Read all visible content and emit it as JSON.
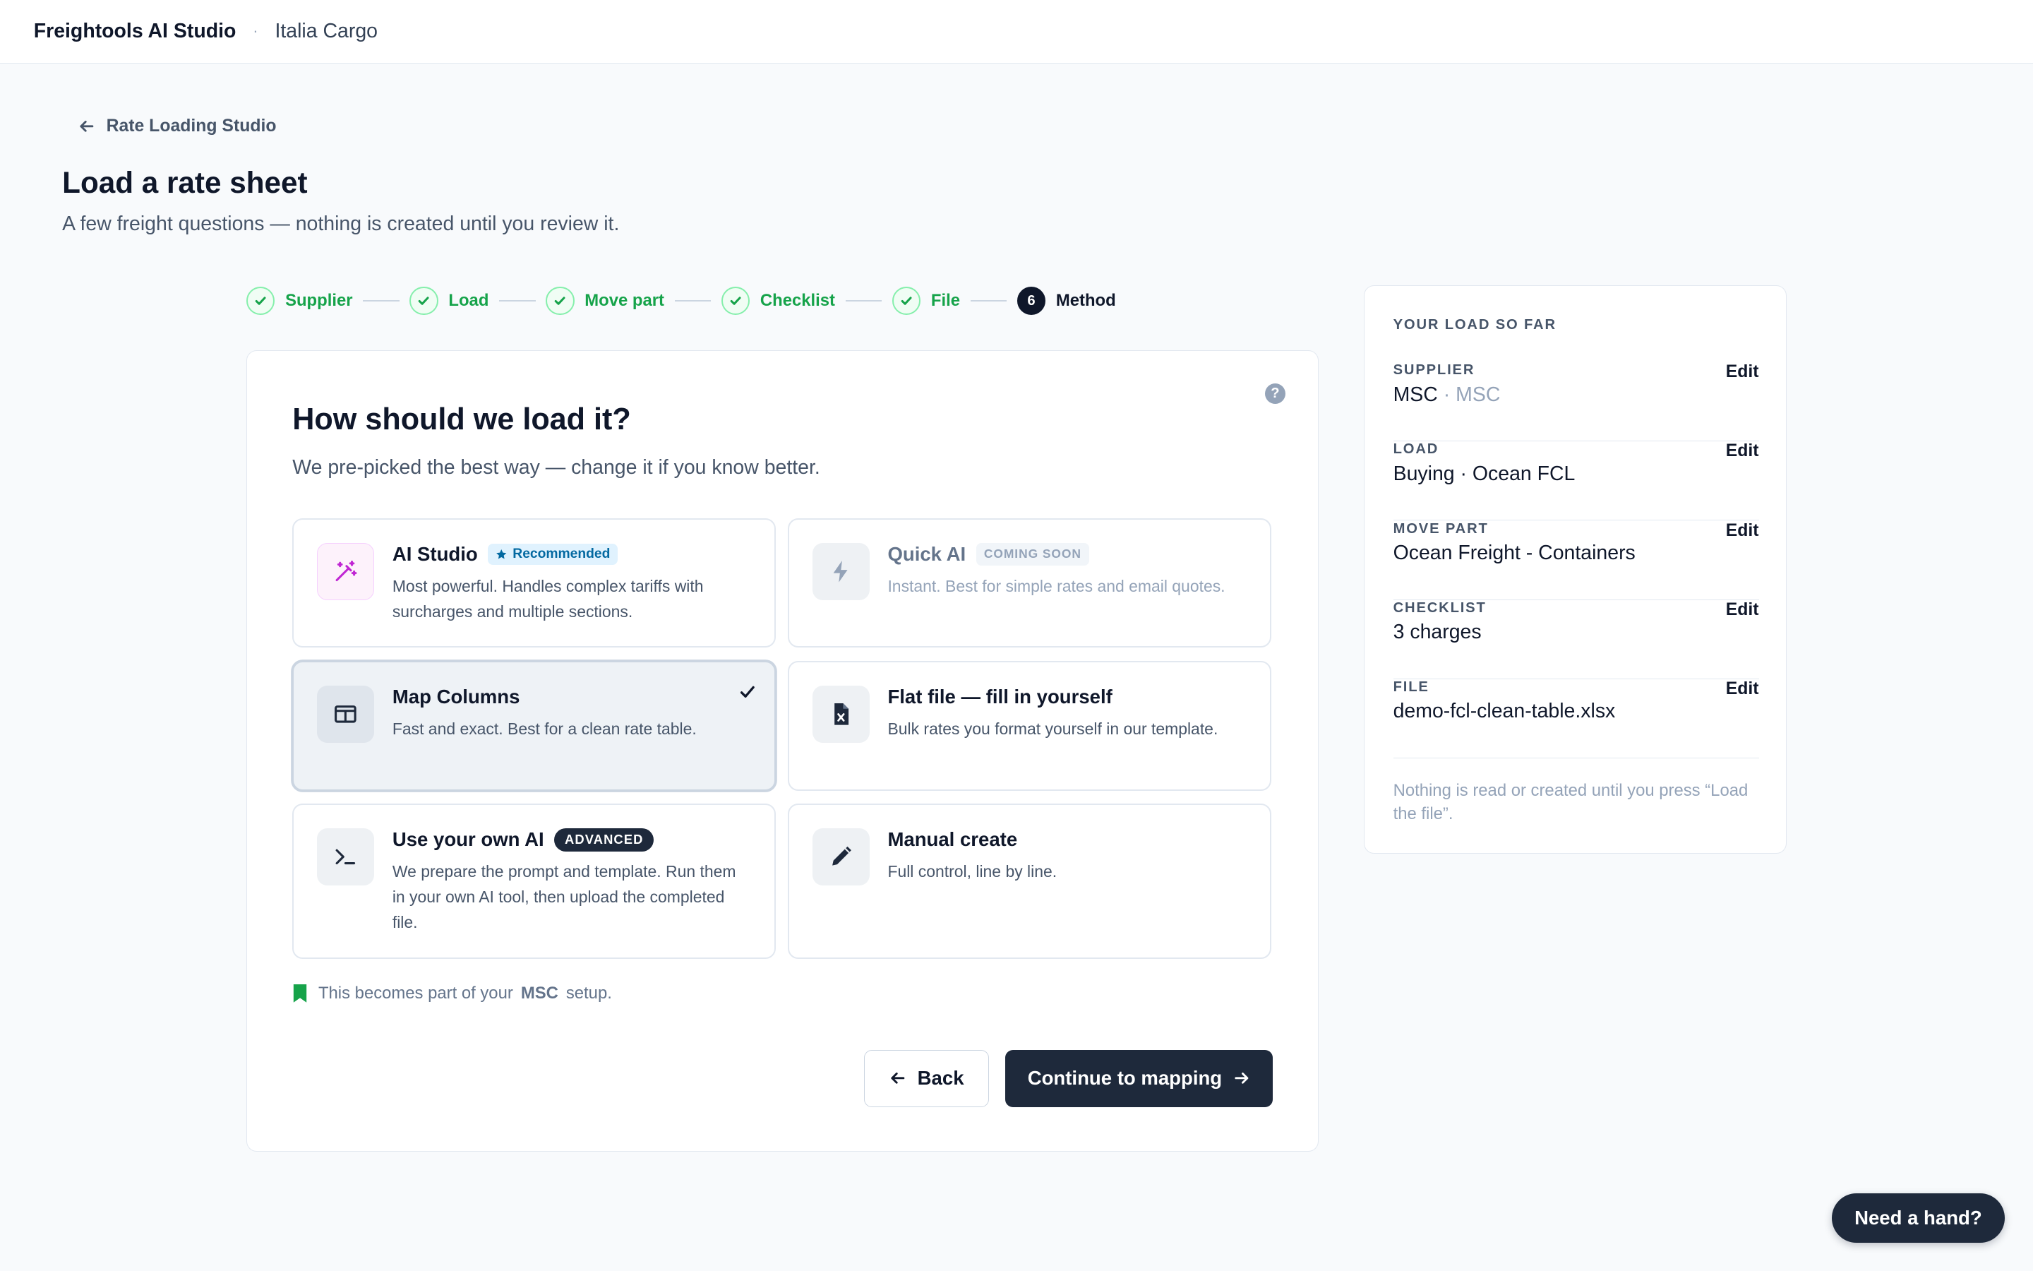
{
  "app": {
    "title": "Freightools AI Studio",
    "separator": "·",
    "org": "Italia Cargo"
  },
  "nav": {
    "back_label": "Rate Loading Studio"
  },
  "page": {
    "title": "Load a rate sheet",
    "subtitle": "A few freight questions — nothing is created until you review it."
  },
  "stepper": {
    "steps": [
      {
        "label": "Supplier",
        "state": "done"
      },
      {
        "label": "Load",
        "state": "done"
      },
      {
        "label": "Move part",
        "state": "done"
      },
      {
        "label": "Checklist",
        "state": "done"
      },
      {
        "label": "File",
        "state": "done"
      },
      {
        "label": "Method",
        "number": "6",
        "state": "current"
      }
    ]
  },
  "method": {
    "help": "?",
    "title": "How should we load it?",
    "subtitle": "We pre-picked the best way — change it if you know better.",
    "options": [
      {
        "id": "ai-studio",
        "title": "AI Studio",
        "badge": "Recommended",
        "icon": "magic-wand-icon",
        "desc": "Most powerful. Handles complex tariffs with surcharges and multiple sections."
      },
      {
        "id": "quick-ai",
        "title": "Quick AI",
        "badge": "COMING SOON",
        "icon": "lightning-icon",
        "desc": "Instant. Best for simple rates and email quotes.",
        "disabled": true
      },
      {
        "id": "map-columns",
        "title": "Map Columns",
        "icon": "columns-icon",
        "desc": "Fast and exact. Best for a clean rate table.",
        "selected": true
      },
      {
        "id": "flat-file",
        "title": "Flat file — fill in yourself",
        "icon": "excel-file-icon",
        "desc": "Bulk rates you format yourself in our template."
      },
      {
        "id": "own-ai",
        "title": "Use your own AI",
        "badge": "ADVANCED",
        "icon": "terminal-icon",
        "desc": "We prepare the prompt and template. Run them in your own AI tool, then upload the completed file."
      },
      {
        "id": "manual",
        "title": "Manual create",
        "icon": "pencil-icon",
        "desc": "Full control, line by line."
      }
    ],
    "note": {
      "prefix": "This becomes part of your",
      "supplier": "MSC",
      "suffix": "setup."
    },
    "back_label": "Back",
    "continue_label": "Continue to mapping"
  },
  "summary": {
    "heading": "YOUR LOAD SO FAR",
    "edit_label": "Edit",
    "rows": [
      {
        "label": "SUPPLIER",
        "value": "MSC",
        "separator": "·",
        "secondary": "MSC"
      },
      {
        "label": "LOAD",
        "value": "Buying · Ocean FCL"
      },
      {
        "label": "MOVE PART",
        "value": "Ocean Freight - Containers"
      },
      {
        "label": "CHECKLIST",
        "value": "3 charges"
      },
      {
        "label": "FILE",
        "value": "demo-fcl-clean-table.xlsx"
      }
    ],
    "footnote": "Nothing is read or created until you press “Load the file”."
  },
  "help_button": "Need a hand?",
  "colors": {
    "accent": "#1e293b",
    "success": "#16a34a",
    "info_badge": "#0369a1",
    "ai_purple": "#c026d3"
  }
}
